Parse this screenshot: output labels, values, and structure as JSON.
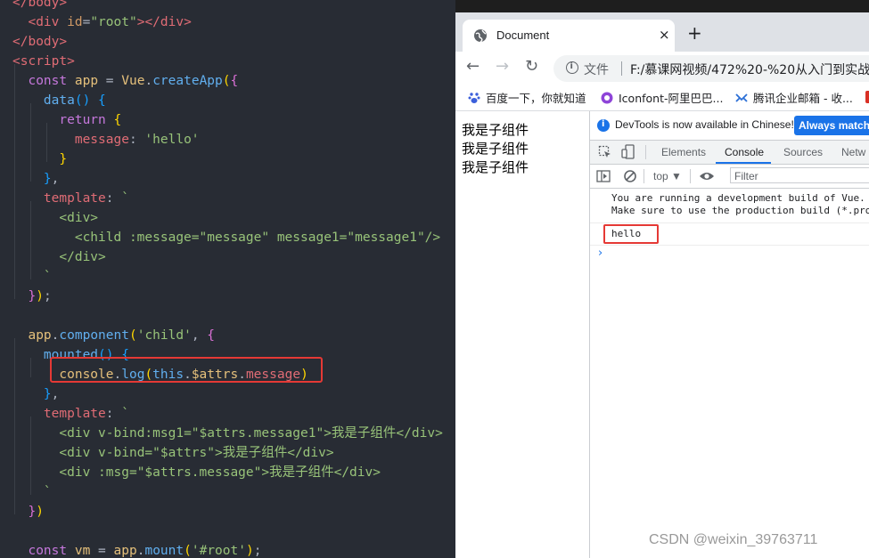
{
  "editor": {
    "lines": [
      [
        [
          "tk-tag",
          "</body>"
        ]
      ],
      [
        [
          "tk-punct",
          "  "
        ],
        [
          "tk-tag",
          "<div"
        ],
        [
          "tk-plain",
          " "
        ],
        [
          "tk-attr",
          "id"
        ],
        [
          "tk-punct",
          "="
        ],
        [
          "tk-str",
          "\"root\""
        ],
        [
          "tk-tag",
          "></div>"
        ]
      ],
      [
        [
          "tk-tag",
          "</body>"
        ]
      ],
      [
        [
          "tk-tag",
          "<script>"
        ]
      ],
      [
        [
          "tk-plain",
          "  "
        ],
        [
          "tk-kw",
          "const"
        ],
        [
          "tk-plain",
          " "
        ],
        [
          "tk-var",
          "app"
        ],
        [
          "tk-plain",
          " = "
        ],
        [
          "tk-var",
          "Vue"
        ],
        [
          "tk-punct",
          "."
        ],
        [
          "tk-fn",
          "createApp"
        ],
        [
          "tk-brace1",
          "("
        ],
        [
          "tk-brace2",
          "{"
        ]
      ],
      [
        [
          "tk-plain",
          "    "
        ],
        [
          "tk-fn",
          "data"
        ],
        [
          "tk-brace3",
          "()"
        ],
        [
          "tk-plain",
          " "
        ],
        [
          "tk-brace3",
          "{"
        ]
      ],
      [
        [
          "tk-plain",
          "      "
        ],
        [
          "tk-kw",
          "return"
        ],
        [
          "tk-plain",
          " "
        ],
        [
          "tk-brace1",
          "{"
        ]
      ],
      [
        [
          "tk-plain",
          "        "
        ],
        [
          "tk-prop",
          "message"
        ],
        [
          "tk-plain",
          ": "
        ],
        [
          "tk-str",
          "'hello'"
        ]
      ],
      [
        [
          "tk-plain",
          "      "
        ],
        [
          "tk-brace1",
          "}"
        ]
      ],
      [
        [
          "tk-plain",
          "    "
        ],
        [
          "tk-brace3",
          "}"
        ],
        [
          "tk-punct",
          ","
        ]
      ],
      [
        [
          "tk-plain",
          "    "
        ],
        [
          "tk-prop",
          "template"
        ],
        [
          "tk-plain",
          ": "
        ],
        [
          "tk-str",
          "`"
        ]
      ],
      [
        [
          "tk-plain",
          "      "
        ],
        [
          "tk-str",
          "<div>"
        ]
      ],
      [
        [
          "tk-plain",
          "        "
        ],
        [
          "tk-str",
          "<child :message=\"message\" message1=\"message1\"/>"
        ]
      ],
      [
        [
          "tk-plain",
          "      "
        ],
        [
          "tk-str",
          "</div>"
        ]
      ],
      [
        [
          "tk-plain",
          "    "
        ],
        [
          "tk-str",
          "`"
        ]
      ],
      [
        [
          "tk-plain",
          "  "
        ],
        [
          "tk-brace2",
          "}"
        ],
        [
          "tk-brace1",
          ")"
        ],
        [
          "tk-punct",
          ";"
        ]
      ],
      [
        [
          "tk-plain",
          ""
        ]
      ],
      [
        [
          "tk-plain",
          "  "
        ],
        [
          "tk-var",
          "app"
        ],
        [
          "tk-punct",
          "."
        ],
        [
          "tk-fn",
          "component"
        ],
        [
          "tk-brace1",
          "("
        ],
        [
          "tk-str",
          "'child'"
        ],
        [
          "tk-punct",
          ", "
        ],
        [
          "tk-brace2",
          "{"
        ]
      ],
      [
        [
          "tk-plain",
          "    "
        ],
        [
          "tk-fn",
          "mounted"
        ],
        [
          "tk-brace3",
          "()"
        ],
        [
          "tk-plain",
          " "
        ],
        [
          "tk-brace3",
          "{"
        ]
      ],
      [
        [
          "tk-plain",
          "      "
        ],
        [
          "tk-var",
          "console"
        ],
        [
          "tk-punct",
          "."
        ],
        [
          "tk-fn",
          "log"
        ],
        [
          "tk-brace1",
          "("
        ],
        [
          "tk-this",
          "this"
        ],
        [
          "tk-punct",
          "."
        ],
        [
          "tk-var",
          "$attrs"
        ],
        [
          "tk-punct",
          "."
        ],
        [
          "tk-prop",
          "message"
        ],
        [
          "tk-brace1",
          ")"
        ]
      ],
      [
        [
          "tk-plain",
          "    "
        ],
        [
          "tk-brace3",
          "}"
        ],
        [
          "tk-punct",
          ","
        ]
      ],
      [
        [
          "tk-plain",
          "    "
        ],
        [
          "tk-prop",
          "template"
        ],
        [
          "tk-plain",
          ": "
        ],
        [
          "tk-str",
          "`"
        ]
      ],
      [
        [
          "tk-plain",
          "      "
        ],
        [
          "tk-str",
          "<div v-bind:msg1=\"$attrs.message1\">我是子组件</div>"
        ]
      ],
      [
        [
          "tk-plain",
          "      "
        ],
        [
          "tk-str",
          "<div v-bind=\"$attrs\">我是子组件</div>"
        ]
      ],
      [
        [
          "tk-plain",
          "      "
        ],
        [
          "tk-str",
          "<div :msg=\"$attrs.message\">我是子组件</div>"
        ]
      ],
      [
        [
          "tk-plain",
          "    "
        ],
        [
          "tk-str",
          "`"
        ]
      ],
      [
        [
          "tk-plain",
          "  "
        ],
        [
          "tk-brace2",
          "}"
        ],
        [
          "tk-brace1",
          ")"
        ]
      ],
      [
        [
          "tk-plain",
          ""
        ]
      ],
      [
        [
          "tk-plain",
          "  "
        ],
        [
          "tk-kw",
          "const"
        ],
        [
          "tk-plain",
          " "
        ],
        [
          "tk-var",
          "vm"
        ],
        [
          "tk-plain",
          " = "
        ],
        [
          "tk-var",
          "app"
        ],
        [
          "tk-punct",
          "."
        ],
        [
          "tk-fn",
          "mount"
        ],
        [
          "tk-brace1",
          "("
        ],
        [
          "tk-str",
          "'#root'"
        ],
        [
          "tk-brace1",
          ")"
        ],
        [
          "tk-punct",
          ";"
        ]
      ]
    ]
  },
  "browser": {
    "tab_title": "Document",
    "tab_close": "×",
    "new_tab": "+",
    "back": "←",
    "forward": "→",
    "reload": "↻",
    "secure_label": "文件",
    "url": "F:/慕课网视频/472%20-%20从入门到实战%",
    "bookmarks": [
      {
        "label": "百度一下，你就知道",
        "icon": "baidu-paw-icon",
        "color": "#3b5fdb"
      },
      {
        "label": "Iconfont-阿里巴巴...",
        "icon": "iconfont-icon",
        "color": "#8e44d8"
      },
      {
        "label": "腾讯企业邮箱 - 收...",
        "icon": "tencent-mail-icon",
        "color": "#2b6fd6"
      }
    ],
    "page_lines": [
      "我是子组件",
      "我是子组件",
      "我是子组件"
    ]
  },
  "devtools": {
    "info_text": "DevTools is now available in Chinese!",
    "always_match": "Always match C",
    "tabs": [
      "Elements",
      "Console",
      "Sources",
      "Netw"
    ],
    "active_tab": "Console",
    "context": "top ▼",
    "filter_placeholder": "Filter",
    "messages": [
      {
        "text": "You are running a development build of Vue.\nMake sure to use the production build (*.pro"
      },
      {
        "text": "hello"
      }
    ],
    "prompt": "›"
  },
  "watermark": "CSDN @weixin_39763711",
  "colors": {
    "highlight_box": "#e53935",
    "accent_blue": "#1a73e8",
    "editor_bg": "#282c34"
  }
}
